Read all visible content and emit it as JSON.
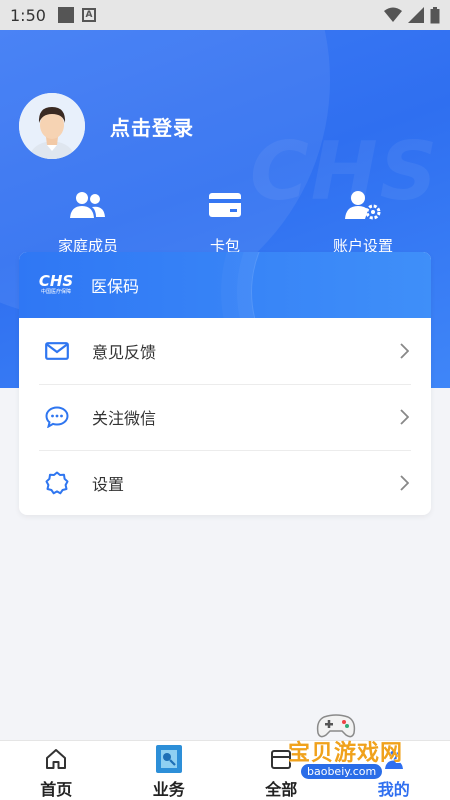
{
  "status_bar": {
    "time": "1:50",
    "a_label": "A"
  },
  "header": {
    "login_text": "点击登录"
  },
  "quick_actions": [
    {
      "label": "家庭成员",
      "icon": "family-icon"
    },
    {
      "label": "卡包",
      "icon": "card-icon"
    },
    {
      "label": "账户设置",
      "icon": "account-settings-icon"
    }
  ],
  "card": {
    "logo_text": "CHS",
    "logo_sub": "中国医疗保障",
    "title": "医保码",
    "rows": [
      {
        "label": "意见反馈",
        "icon": "mail-icon"
      },
      {
        "label": "关注微信",
        "icon": "chat-icon"
      },
      {
        "label": "设置",
        "icon": "settings-icon"
      }
    ]
  },
  "watermark_bg": "CHS",
  "nav": {
    "items": [
      {
        "label": "首页",
        "icon": "home-icon"
      },
      {
        "label": "业务",
        "icon": "business-icon"
      },
      {
        "label": "全部",
        "icon": "all-icon"
      },
      {
        "label": "我的",
        "icon": "profile-icon",
        "active": true
      }
    ]
  },
  "overlay_brand": {
    "title": "宝贝游戏网",
    "url": "baobeiy.com"
  },
  "colors": {
    "primary": "#2f6ff0",
    "accent": "#f0a21c"
  }
}
